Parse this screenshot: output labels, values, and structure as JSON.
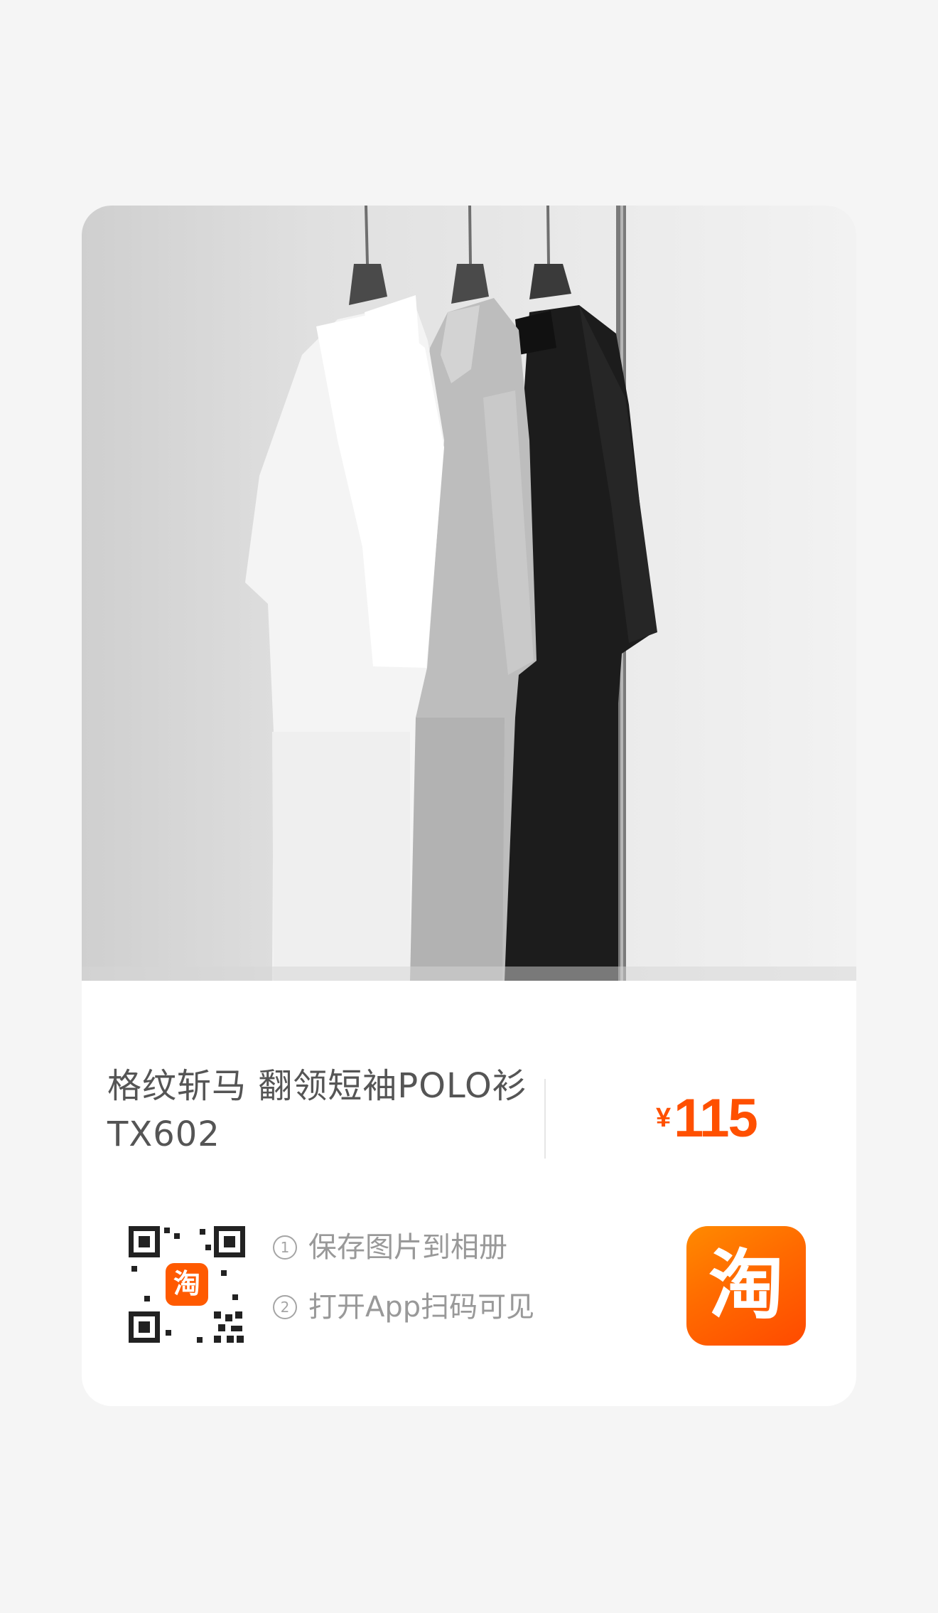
{
  "product": {
    "title": "格纹斩马 翻领短袖POLO衫TX602",
    "currency_symbol": "¥",
    "price": "115",
    "price_color": "#ff5000"
  },
  "share": {
    "qr_badge_text": "淘",
    "steps": [
      {
        "num": "1",
        "text": "保存图片到相册"
      },
      {
        "num": "2",
        "text": "打开App扫码可见"
      }
    ],
    "app_logo_text": "淘",
    "brand_color": "#ff6a00"
  },
  "photo": {
    "description_icon": "product-photo"
  }
}
